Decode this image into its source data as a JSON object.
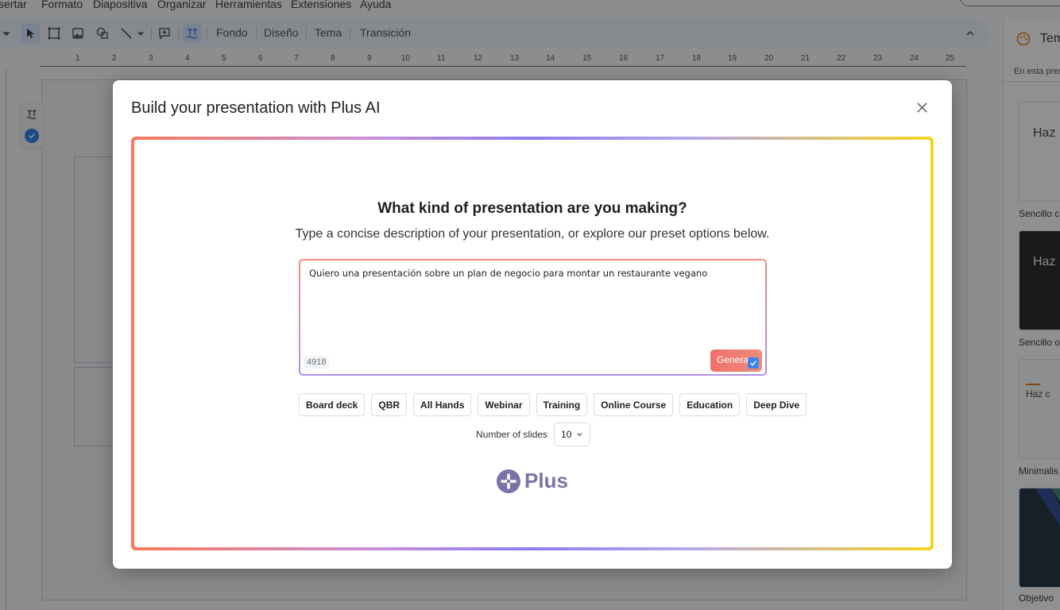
{
  "menu": [
    "sertar",
    "Formato",
    "Diapositiva",
    "Organizar",
    "Herramientas",
    "Extensiones",
    "Ayuda"
  ],
  "toolbar": {
    "items": [
      "Fondo",
      "Diseño",
      "Tema",
      "Transición"
    ]
  },
  "ruler": [
    "1",
    "2",
    "3",
    "4",
    "5",
    "6",
    "7",
    "8",
    "9",
    "10",
    "11",
    "12",
    "13",
    "14",
    "15",
    "16",
    "17",
    "18",
    "19",
    "20",
    "21",
    "22",
    "23",
    "24",
    "25"
  ],
  "side_panel": {
    "title": "Tem",
    "subtitle": "En esta pres",
    "themes": [
      {
        "preview": "Haz",
        "label": "Sencillo c"
      },
      {
        "preview": "Haz",
        "label": "Sencillo o"
      },
      {
        "preview": "Haz c",
        "label": "Minimalis"
      },
      {
        "preview": "",
        "label": "Objetivo"
      }
    ]
  },
  "modal": {
    "title": "Build your presentation with Plus AI",
    "heading": "What kind of presentation are you making?",
    "subheading": "Type a concise description of your presentation, or explore our preset options below.",
    "prompt_value": "Quiero una presentación sobre un plan de negocio para montar un restaurante vegano",
    "char_count": "4918",
    "generate_label": "Genera",
    "presets": [
      "Board deck",
      "QBR",
      "All Hands",
      "Webinar",
      "Training",
      "Online Course",
      "Education",
      "Deep Dive"
    ],
    "slides_label": "Number of slides",
    "slides_value": "10",
    "brand": "Plus"
  },
  "colors": {
    "accent": "#1a73e8",
    "brand": "#7b72a8",
    "gradient_start": "#f87b5a",
    "gradient_mid": "#8b7ff2",
    "gradient_end": "#f5d522"
  }
}
